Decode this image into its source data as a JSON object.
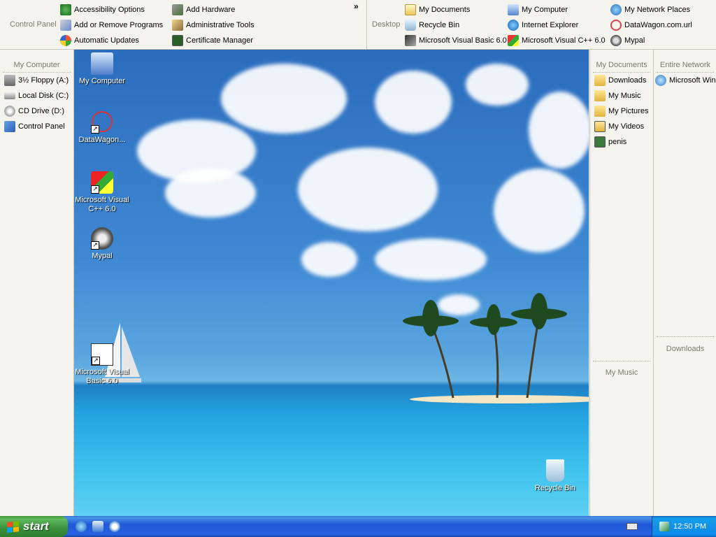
{
  "topbar": {
    "control_panel_label": "Control Panel",
    "more_glyph": "»",
    "control_panel_items": [
      {
        "label": "Accessibility Options",
        "icon": "accessibility-icon"
      },
      {
        "label": "Add or Remove Programs",
        "icon": "add-remove-programs-icon"
      },
      {
        "label": "Automatic Updates",
        "icon": "automatic-updates-icon"
      },
      {
        "label": "Add Hardware",
        "icon": "add-hardware-icon"
      },
      {
        "label": "Administrative Tools",
        "icon": "administrative-tools-icon"
      },
      {
        "label": "Certificate Manager",
        "icon": "certificate-manager-icon"
      }
    ],
    "desktop_label": "Desktop",
    "desktop_items": [
      {
        "label": "My Documents",
        "icon": "my-documents-icon"
      },
      {
        "label": "Recycle Bin",
        "icon": "recycle-bin-icon"
      },
      {
        "label": "Microsoft Visual Basic 6.0",
        "icon": "visual-basic-icon"
      },
      {
        "label": "My Computer",
        "icon": "my-computer-icon"
      },
      {
        "label": "Internet Explorer",
        "icon": "internet-explorer-icon"
      },
      {
        "label": "Microsoft Visual C++ 6.0",
        "icon": "visual-cpp-icon"
      },
      {
        "label": "My Network Places",
        "icon": "network-places-icon"
      },
      {
        "label": "DataWagon.com.url",
        "icon": "datawagon-icon"
      },
      {
        "label": "Mypal",
        "icon": "mypal-icon"
      }
    ]
  },
  "left_panel": {
    "title": "My Computer",
    "items": [
      {
        "label": "3½ Floppy (A:)",
        "icon": "floppy-drive-icon"
      },
      {
        "label": "Local Disk (C:)",
        "icon": "hard-disk-icon"
      },
      {
        "label": "CD Drive (D:)",
        "icon": "cd-drive-icon"
      },
      {
        "label": "Control Panel",
        "icon": "control-panel-icon"
      }
    ]
  },
  "desktop_icons": [
    {
      "label": "My Computer",
      "icon": "my-computer-icon"
    },
    {
      "label": "DataWagon...",
      "icon": "datawagon-icon"
    },
    {
      "label": "Microsoft Visual C++ 6.0",
      "icon": "visual-cpp-icon"
    },
    {
      "label": "Mypal",
      "icon": "mypal-icon"
    },
    {
      "label": "Microsoft Visual Basic 6.0",
      "icon": "visual-basic-icon"
    },
    {
      "label": "Recycle Bin",
      "icon": "recycle-bin-icon"
    }
  ],
  "right_panel_documents": {
    "title": "My Documents",
    "items": [
      {
        "label": "Downloads",
        "icon": "folder-icon"
      },
      {
        "label": "My Music",
        "icon": "music-folder-icon"
      },
      {
        "label": "My Pictures",
        "icon": "pictures-folder-icon"
      },
      {
        "label": "My Videos",
        "icon": "videos-folder-icon"
      },
      {
        "label": "penis",
        "icon": "image-file-icon"
      }
    ],
    "sub_title": "My Music"
  },
  "right_panel_network": {
    "title": "Entire Network",
    "items": [
      {
        "label": "Microsoft Win",
        "icon": "windows-network-icon"
      }
    ],
    "sub_title": "Downloads"
  },
  "taskbar": {
    "start_label": "start",
    "quick_launch": [
      "internet-explorer-icon",
      "outlook-express-icon",
      "media-player-icon"
    ],
    "tray_icons": [
      "keyboard-icon",
      "network-icon"
    ],
    "clock": "12:50 PM"
  },
  "colors": {
    "panel_bg": "#F4F3EE",
    "taskbar_blue": "#2157D7",
    "start_green": "#3A8F3A",
    "tray_blue": "#1290E8"
  }
}
